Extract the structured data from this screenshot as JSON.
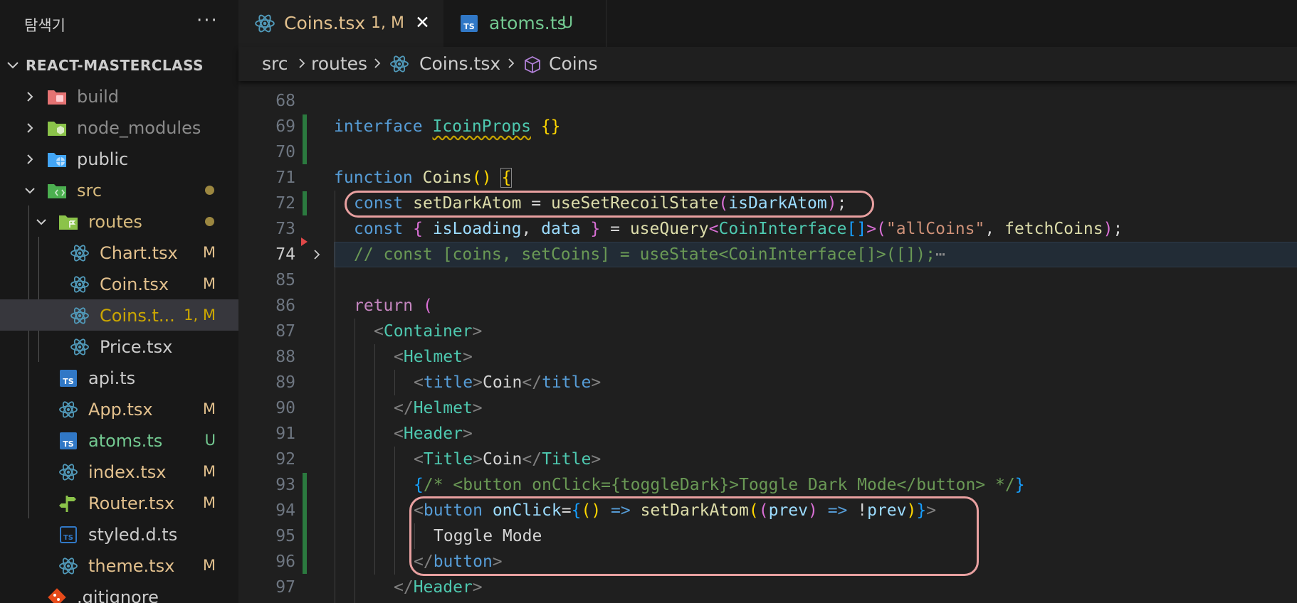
{
  "sidebar": {
    "title": "탐색기",
    "more": "···",
    "project": "REACT-MASTERCLASS",
    "items": [
      {
        "label": "build",
        "badge": "",
        "icon": "folder-icon-build"
      },
      {
        "label": "node_modules",
        "badge": "",
        "icon": "folder-icon-node"
      },
      {
        "label": "public",
        "badge": "",
        "icon": "folder-icon-public"
      },
      {
        "label": "src",
        "badge": "",
        "icon": "folder-icon-src"
      },
      {
        "label": "routes",
        "badge": "",
        "icon": "folder-icon-routes"
      },
      {
        "label": "Chart.tsx",
        "badge": "M",
        "icon": "react-icon"
      },
      {
        "label": "Coin.tsx",
        "badge": "M",
        "icon": "react-icon"
      },
      {
        "label": "Coins.t...",
        "badge": "1, M",
        "icon": "react-icon"
      },
      {
        "label": "Price.tsx",
        "badge": "",
        "icon": "react-icon"
      },
      {
        "label": "api.ts",
        "badge": "",
        "icon": "ts-icon"
      },
      {
        "label": "App.tsx",
        "badge": "M",
        "icon": "react-icon"
      },
      {
        "label": "atoms.ts",
        "badge": "U",
        "icon": "ts-icon"
      },
      {
        "label": "index.tsx",
        "badge": "M",
        "icon": "react-icon"
      },
      {
        "label": "Router.tsx",
        "badge": "M",
        "icon": "router-icon"
      },
      {
        "label": "styled.d.ts",
        "badge": "",
        "icon": "ts-outline-icon"
      },
      {
        "label": "theme.tsx",
        "badge": "M",
        "icon": "react-icon"
      },
      {
        "label": ".gitignore",
        "badge": "",
        "icon": "git-icon"
      }
    ]
  },
  "tabs": [
    {
      "label": "Coins.tsx",
      "meta": "1, M",
      "close": "✕"
    },
    {
      "label": "atoms.ts",
      "meta": "U"
    }
  ],
  "breadcrumb": [
    "src",
    "routes",
    "Coins.tsx",
    "Coins"
  ],
  "code": {
    "lines": [
      {
        "n": "68"
      },
      {
        "n": "69"
      },
      {
        "n": "70"
      },
      {
        "n": "71"
      },
      {
        "n": "72"
      },
      {
        "n": "73"
      },
      {
        "n": "74"
      },
      {
        "n": "85"
      },
      {
        "n": "86"
      },
      {
        "n": "87"
      },
      {
        "n": "88"
      },
      {
        "n": "89"
      },
      {
        "n": "90"
      },
      {
        "n": "91"
      },
      {
        "n": "92"
      },
      {
        "n": "93"
      },
      {
        "n": "94"
      },
      {
        "n": "95"
      },
      {
        "n": "96"
      },
      {
        "n": "97"
      }
    ],
    "l69": {
      "a": "interface",
      "b": "IcoinProps",
      "c": "{}"
    },
    "l71": {
      "a": "function",
      "b": "Coins",
      "c": "()",
      "d": "{"
    },
    "l72": {
      "a": "const",
      "b": "setDarkAtom",
      "c": " = ",
      "d": "useSetRecoilState",
      "e": "(",
      "f": "isDarkAtom",
      "g": ")",
      "h": ";"
    },
    "l73": {
      "a": "const",
      "b": "{",
      "c": "isLoading",
      "d": ",",
      "e": "data",
      "f": "}",
      "g": " = ",
      "h": "useQuery",
      "i": "<",
      "j": "CoinInterface",
      "k": "[]",
      "l": ">",
      "m": "(",
      "n": "\"allCoins\"",
      "o": ", ",
      "p": "fetchCoins",
      "q": ")",
      "r": ";"
    },
    "l74": {
      "text": "// const [coins, setCoins] = useState<CoinInterface[]>([]);",
      "more": "⋯"
    },
    "l86": {
      "a": "return",
      "b": "("
    },
    "l87": {
      "a": "<",
      "b": "Container",
      "c": ">"
    },
    "l88": {
      "a": "<",
      "b": "Helmet",
      "c": ">"
    },
    "l89": {
      "a": "<",
      "b": "title",
      "c": ">",
      "d": "Coin",
      "e": "</",
      "f": "title",
      "g": ">"
    },
    "l90": {
      "a": "</",
      "b": "Helmet",
      "c": ">"
    },
    "l91": {
      "a": "<",
      "b": "Header",
      "c": ">"
    },
    "l92": {
      "a": "<",
      "b": "Title",
      "c": ">",
      "d": "Coin",
      "e": "</",
      "f": "Title",
      "g": ">"
    },
    "l93": {
      "a": "{",
      "b": "/* <button onClick={toggleDark}>Toggle Dark Mode</button> */",
      "c": "}"
    },
    "l94": {
      "a": "<",
      "b": "button",
      "c": "onClick",
      "d": "=",
      "e": "{",
      "f": "()",
      "g": " => ",
      "h": "setDarkAtom",
      "i": "(",
      "j": "(",
      "k": "prev",
      "l": ")",
      "m": " => ",
      "n": "!",
      "o": "prev",
      "p": ")",
      "q": "}",
      "r": ">"
    },
    "l95": {
      "text": "Toggle Mode"
    },
    "l96": {
      "a": "</",
      "b": "button",
      "c": ">"
    },
    "l97": {
      "a": "</",
      "b": "Header",
      "c": ">"
    }
  }
}
